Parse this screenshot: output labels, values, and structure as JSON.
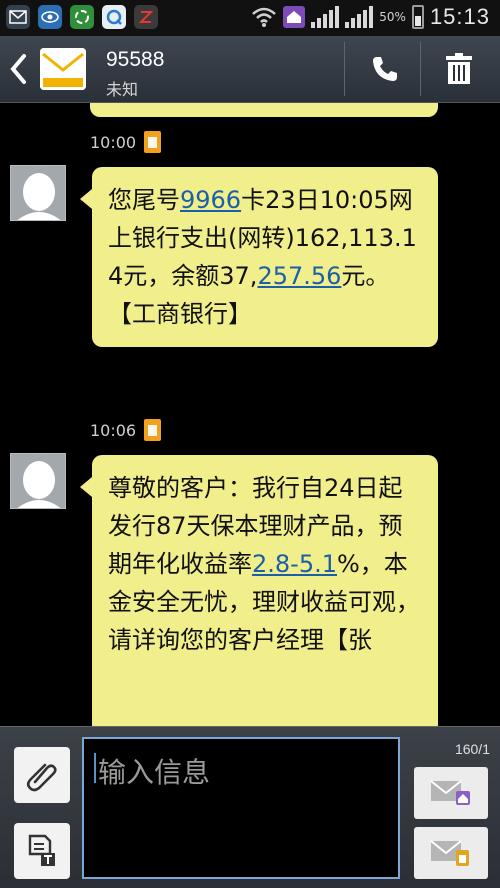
{
  "status_bar": {
    "battery_text": "50%",
    "clock": "15:13",
    "notification_icons": [
      "email-icon",
      "eye-icon",
      "sync-icon",
      "qq-icon",
      "app-icon"
    ]
  },
  "header": {
    "contact_number": "95588",
    "contact_status": "未知"
  },
  "messages": [
    {
      "time": "10:00"
    },
    {
      "time": "10:06",
      "parts": [
        {
          "text": "您尾号",
          "link": false
        },
        {
          "text": "9966",
          "link": true
        },
        {
          "text": "卡23日10:05网上银行支出(网转)162,113.14元，余额37,",
          "link": false
        },
        {
          "text": "257.56",
          "link": true
        },
        {
          "text": "元。【工商银行】",
          "link": false
        }
      ]
    },
    {
      "parts": [
        {
          "text": "尊敬的客户：我行自24日起发行87天保本理财产品，预期年化收益率",
          "link": false
        },
        {
          "text": "2.8-5.1",
          "link": true
        },
        {
          "text": "%，本金安全无忧，理财收益可观，请详询您的客户经理【张",
          "link": false
        }
      ]
    }
  ],
  "composer": {
    "placeholder": "输入信息",
    "counter": "160/1"
  },
  "colors": {
    "bubble": "#f1ee8c",
    "link": "#1b5fa8",
    "header": "#3a4048"
  }
}
